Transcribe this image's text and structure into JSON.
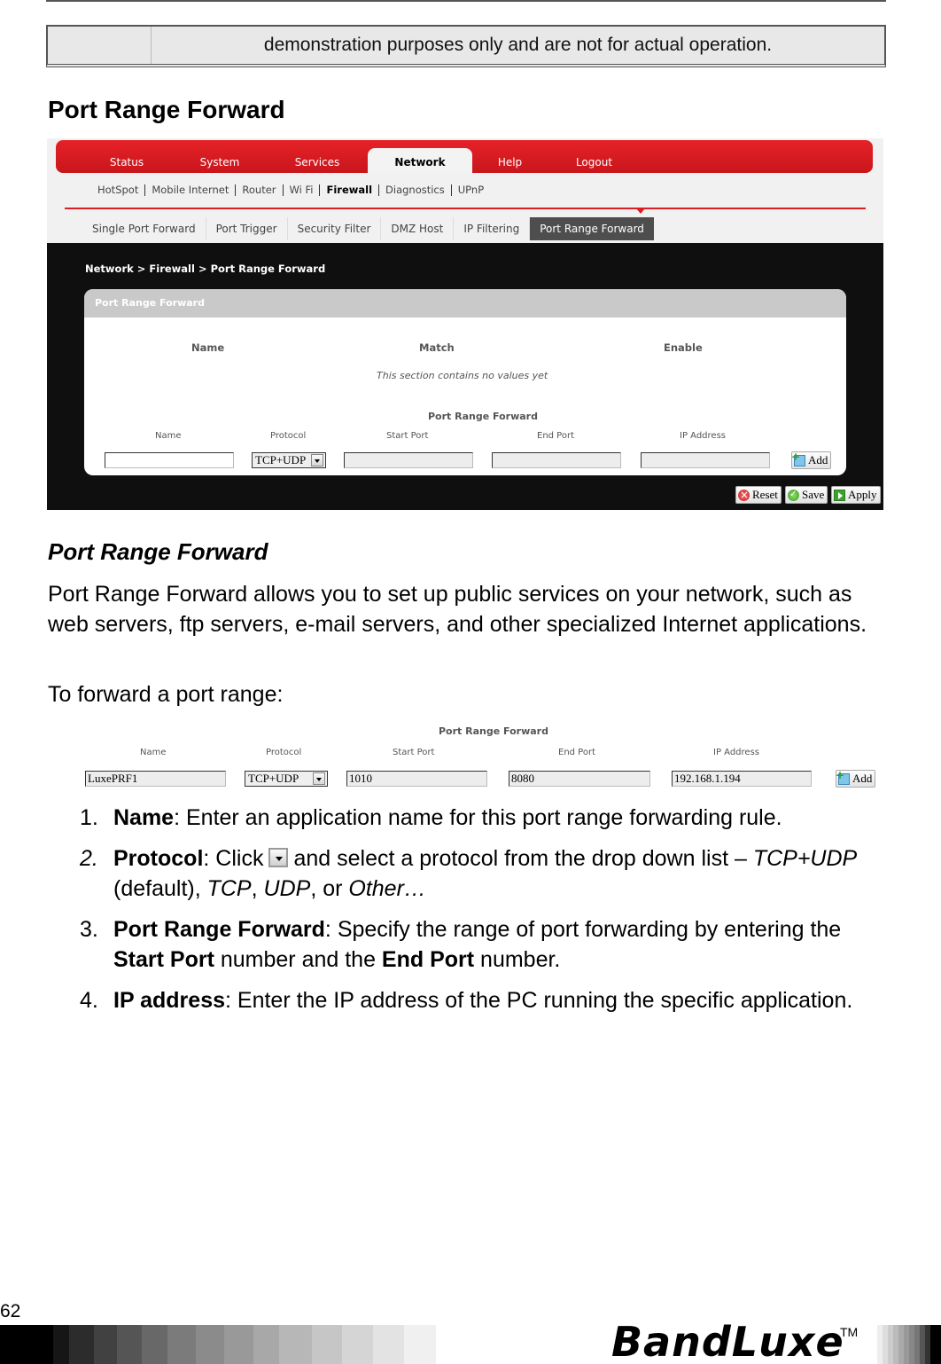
{
  "note": {
    "text": "demonstration purposes only and are not for actual operation."
  },
  "section_title": "Port Range Forward",
  "screenshot1": {
    "main_tabs": [
      {
        "label": "Status",
        "active": false
      },
      {
        "label": "System",
        "active": false
      },
      {
        "label": "Services",
        "active": false
      },
      {
        "label": "Network",
        "active": true
      },
      {
        "label": "Help",
        "active": false
      },
      {
        "label": "Logout",
        "active": false
      }
    ],
    "sub_tabs": [
      {
        "label": "HotSpot",
        "active": false
      },
      {
        "label": "Mobile Internet",
        "active": false
      },
      {
        "label": "Router",
        "active": false
      },
      {
        "label": "Wi Fi",
        "active": false
      },
      {
        "label": "Firewall",
        "active": true
      },
      {
        "label": "Diagnostics",
        "active": false
      },
      {
        "label": "UPnP",
        "active": false
      }
    ],
    "third_tabs": [
      {
        "label": "Single Port Forward",
        "active": false
      },
      {
        "label": "Port Trigger",
        "active": false
      },
      {
        "label": "Security Filter",
        "active": false
      },
      {
        "label": "DMZ Host",
        "active": false
      },
      {
        "label": "IP Filtering",
        "active": false
      },
      {
        "label": "Port Range Forward",
        "active": true
      }
    ],
    "breadcrumb": "Network > Firewall > Port Range Forward",
    "panel_title": "Port Range Forward",
    "columns": [
      "Name",
      "Match",
      "Enable"
    ],
    "empty_message": "This section contains no values yet",
    "form": {
      "title": "Port Range Forward",
      "labels": {
        "name": "Name",
        "protocol": "Protocol",
        "start_port": "Start Port",
        "end_port": "End Port",
        "ip_address": "IP Address"
      },
      "values": {
        "name": "",
        "protocol": "TCP+UDP",
        "start_port": "",
        "end_port": "",
        "ip_address": ""
      },
      "add_label": "Add"
    },
    "buttons": {
      "reset": "Reset",
      "save": "Save",
      "apply": "Apply"
    }
  },
  "sub_title": "Port Range Forward",
  "paragraphs": [
    "Port Range Forward allows you to set up public services on your network, such as web servers, ftp servers, e-mail servers, and other specialized Internet applications.",
    "To forward a port range:"
  ],
  "screenshot2": {
    "form": {
      "title": "Port Range Forward",
      "labels": {
        "name": "Name",
        "protocol": "Protocol",
        "start_port": "Start Port",
        "end_port": "End Port",
        "ip_address": "IP Address"
      },
      "values": {
        "name": "LuxePRF1",
        "protocol": "TCP+UDP",
        "start_port": "1010",
        "end_port": "8080",
        "ip_address": "192.168.1.194"
      },
      "add_label": "Add"
    }
  },
  "steps": [
    {
      "num": "1.",
      "term": "Name",
      "text": ": Enter an application name for this port range forwarding rule."
    },
    {
      "num": "2.",
      "term": "Protocol",
      "text_a": ": Click",
      "text_b": "and select a protocol from the drop down list –",
      "opt1": "TCP+UDP",
      "text_c": " (default), ",
      "opt2": "TCP",
      "text_d": ", ",
      "opt3": "UDP",
      "text_e": ", or ",
      "opt4": "Other…"
    },
    {
      "num": "3.",
      "term": "Port Range Forward",
      "text_a": ": Specify the range of port forwarding by entering the ",
      "b1": "Start Port",
      "text_b": " number and the ",
      "b2": "End Port",
      "text_c": " number."
    },
    {
      "num": "4.",
      "term": "IP address",
      "text": ": Enter the IP address of the PC running the specific application."
    }
  ],
  "footer": {
    "page_number": "62",
    "brand": "BandLuxe",
    "trademark": "TM"
  }
}
